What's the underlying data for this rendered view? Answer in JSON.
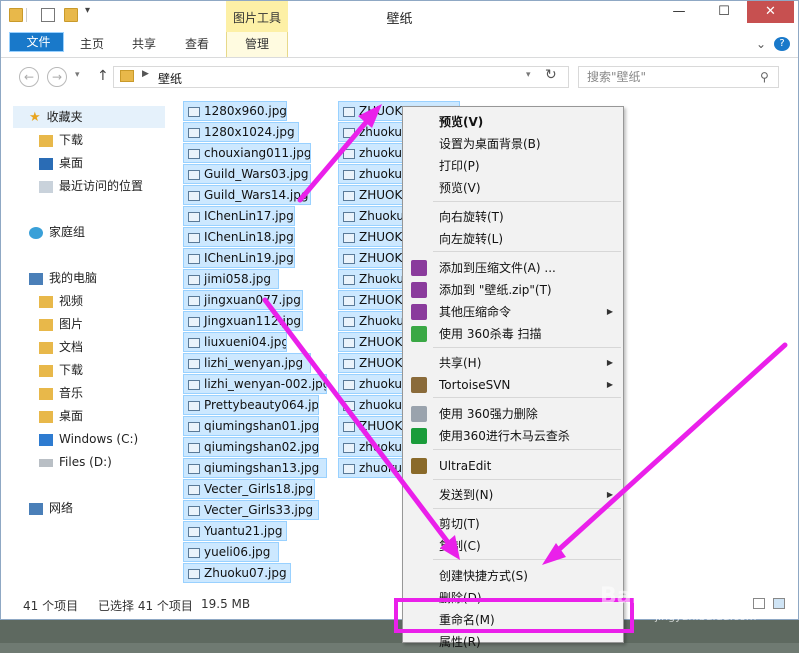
{
  "window": {
    "title": "壁纸",
    "context_tab": "图片工具",
    "controls": {
      "minimize": "—",
      "maximize": "☐",
      "close": "✕"
    }
  },
  "ribbon": {
    "tabs": [
      "文件",
      "主页",
      "共享",
      "查看",
      "管理"
    ],
    "help": "?",
    "expand": "⌄"
  },
  "address": {
    "back": "←",
    "forward": "→",
    "up": "↑",
    "path": "壁纸",
    "search_placeholder": "搜索\"壁纸\""
  },
  "nav": {
    "items": [
      {
        "label": "收藏夹",
        "icon": "star-icon"
      },
      {
        "label": "下载",
        "icon": "folder-icon"
      },
      {
        "label": "桌面",
        "icon": "desktop-icon"
      },
      {
        "label": "最近访问的位置",
        "icon": "recent-icon"
      },
      {
        "label": "家庭组",
        "icon": "homegroup-icon"
      },
      {
        "label": "我的电脑",
        "icon": "computer-icon"
      },
      {
        "label": "视频",
        "icon": "folder-icon"
      },
      {
        "label": "图片",
        "icon": "folder-icon"
      },
      {
        "label": "文档",
        "icon": "folder-icon"
      },
      {
        "label": "下载",
        "icon": "folder-icon"
      },
      {
        "label": "音乐",
        "icon": "folder-icon"
      },
      {
        "label": "桌面",
        "icon": "folder-icon"
      },
      {
        "label": "Windows (C:)",
        "icon": "drive-icon"
      },
      {
        "label": "Files (D:)",
        "icon": "drive-icon"
      },
      {
        "label": "网络",
        "icon": "network-icon"
      }
    ]
  },
  "files_col1": [
    "1280x960.jpg",
    "1280x1024.jpg",
    "chouxiang011.jpg",
    "Guild_Wars03.jpg",
    "Guild_Wars14.jpg",
    "IChenLin17.jpg",
    "IChenLin18.jpg",
    "IChenLin19.jpg",
    "jimi058.jpg",
    "jingxuan077.jpg",
    "Jingxuan112.jpg",
    "liuxueni04.jpg",
    "lizhi_wenyan.jpg",
    "lizhi_wenyan-002.jpg",
    "Prettybeauty064.jpg",
    "qiumingshan01.jpg",
    "qiumingshan02.jpg",
    "qiumingshan13.jpg",
    "Vecter_Girls18.jpg",
    "Vecter_Girls33.jpg",
    "Yuantu21.jpg",
    "yueli06.jpg",
    "Zhuoku07.jpg"
  ],
  "files_col2": [
    "ZHUOKU",
    "zhuoku",
    "zhuoku",
    "zhuoku",
    "ZHUOKU",
    "Zhuoku",
    "ZHUOKU",
    "ZHUOKU",
    "Zhuoku",
    "ZHUOKU",
    "Zhuoku",
    "ZHUOKU",
    "ZHUOKU",
    "zhuoku",
    "zhuoku",
    "ZHUOKU",
    "zhuoku",
    "zhuoku"
  ],
  "context_menu": {
    "items": [
      {
        "label": "预览(V)",
        "bold": true
      },
      {
        "label": "设置为桌面背景(B)"
      },
      {
        "label": "打印(P)"
      },
      {
        "label": "预览(V)"
      },
      {
        "label": "向右旋转(T)"
      },
      {
        "label": "向左旋转(L)"
      },
      {
        "label": "添加到压缩文件(A) ...",
        "icon": "winrar-icon"
      },
      {
        "label": "添加到 \"壁纸.zip\"(T)",
        "icon": "winrar-icon"
      },
      {
        "label": "其他压缩命令",
        "icon": "winrar-icon",
        "submenu": true
      },
      {
        "label": "使用 360杀毒 扫描",
        "icon": "shield-360-icon"
      },
      {
        "label": "共享(H)",
        "submenu": true
      },
      {
        "label": "TortoiseSVN",
        "icon": "tortoise-icon",
        "submenu": true
      },
      {
        "label": "使用 360强力删除",
        "icon": "shredder-icon"
      },
      {
        "label": "使用360进行木马云查杀",
        "icon": "trojan-scan-icon"
      },
      {
        "label": "UltraEdit",
        "icon": "ultraedit-icon"
      },
      {
        "label": "发送到(N)",
        "submenu": true
      },
      {
        "label": "剪切(T)"
      },
      {
        "label": "复制(C)"
      },
      {
        "label": "创建快捷方式(S)"
      },
      {
        "label": "删除(D)"
      },
      {
        "label": "重命名(M)"
      },
      {
        "label": "属性(R)"
      }
    ],
    "submenu_arrow": "▶"
  },
  "status": {
    "count": "41 个项目",
    "selected": "已选择 41 个项目",
    "size": "19.5 MB"
  },
  "colors": {
    "accent": "#1979ca",
    "selection": "#cce8ff",
    "annotation": "#ea20ea"
  },
  "watermark": {
    "logo": "Bai百",
    "url": "jingyan.baidu.com"
  }
}
